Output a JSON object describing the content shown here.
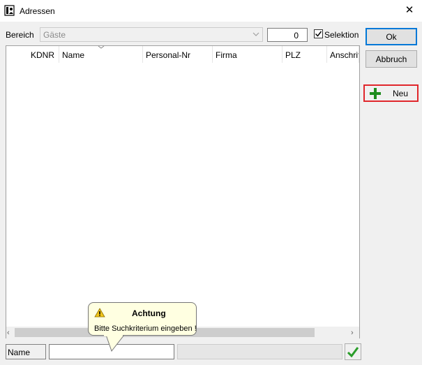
{
  "window": {
    "title": "Adressen"
  },
  "filter": {
    "bereich_label": "Bereich",
    "bereich_value": "Gäste",
    "count": "0",
    "selektion_label": "Selektion",
    "selektion_checked": true
  },
  "buttons": {
    "ok": "Ok",
    "abbruch": "Abbruch",
    "neu": "Neu"
  },
  "table": {
    "columns": [
      "KDNR",
      "Name",
      "Personal-Nr",
      "Firma",
      "PLZ",
      "Anschrift"
    ],
    "rows": []
  },
  "search": {
    "label": "Name",
    "value": ""
  },
  "tooltip": {
    "title": "Achtung",
    "message": "Bitte Suchkriterium eingeben !"
  },
  "icons": {
    "app": "address-book-icon",
    "close": "close-icon",
    "neu": "plus-icon",
    "confirm": "checkmark-icon",
    "warning": "warning-icon"
  },
  "colors": {
    "highlight": "#e0262b",
    "plus_green": "#1e8c1e",
    "check_green": "#2a9d2a"
  }
}
